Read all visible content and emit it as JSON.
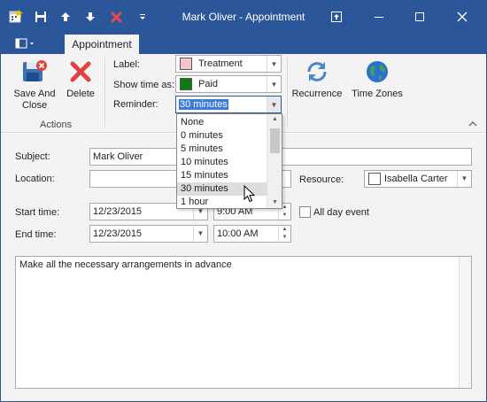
{
  "window": {
    "title": "Mark Oliver - Appointment",
    "accent": "#2b579a"
  },
  "quick_access": {
    "icons": [
      "new-appointment-icon",
      "save-icon",
      "previous-item-icon",
      "next-item-icon",
      "delete-icon",
      "customize-menu-icon"
    ]
  },
  "title_controls": [
    "restore-icon",
    "minimize-icon",
    "maximize-icon",
    "close-icon"
  ],
  "tabs": {
    "file_icon": "file-menu-icon",
    "appointment": "Appointment"
  },
  "ribbon": {
    "actions": {
      "save_and_close_line1": "Save And",
      "save_and_close_line2": "Close",
      "delete": "Delete",
      "group_label": "Actions"
    },
    "options": {
      "label_caption": "Label:",
      "label_value": "Treatment",
      "label_color": "#f4c6cc",
      "show_time_as_caption": "Show time as:",
      "show_time_as_value": "Paid",
      "show_time_as_color": "#0e7a14",
      "reminder_caption": "Reminder:",
      "reminder_value": "30 minutes"
    },
    "recurrence": "Recurrence",
    "time_zones": "Time Zones"
  },
  "reminder_dropdown": {
    "items": [
      "None",
      "0 minutes",
      "5 minutes",
      "10 minutes",
      "15 minutes",
      "30 minutes",
      "1 hour"
    ],
    "hovered_index": 5
  },
  "form": {
    "subject_label": "Subject:",
    "subject_value": "Mark Oliver",
    "location_label": "Location:",
    "location_value": "",
    "resource_label": "Resource:",
    "resource_value": "Isabella Carter",
    "start_label": "Start time:",
    "start_date": "12/23/2015",
    "start_time": "9:00 AM",
    "end_label": "End time:",
    "end_date": "12/23/2015",
    "end_time": "10:00 AM",
    "all_day_label": "All day event",
    "all_day_checked": false,
    "notes": "Make all the necessary arrangements in advance"
  }
}
